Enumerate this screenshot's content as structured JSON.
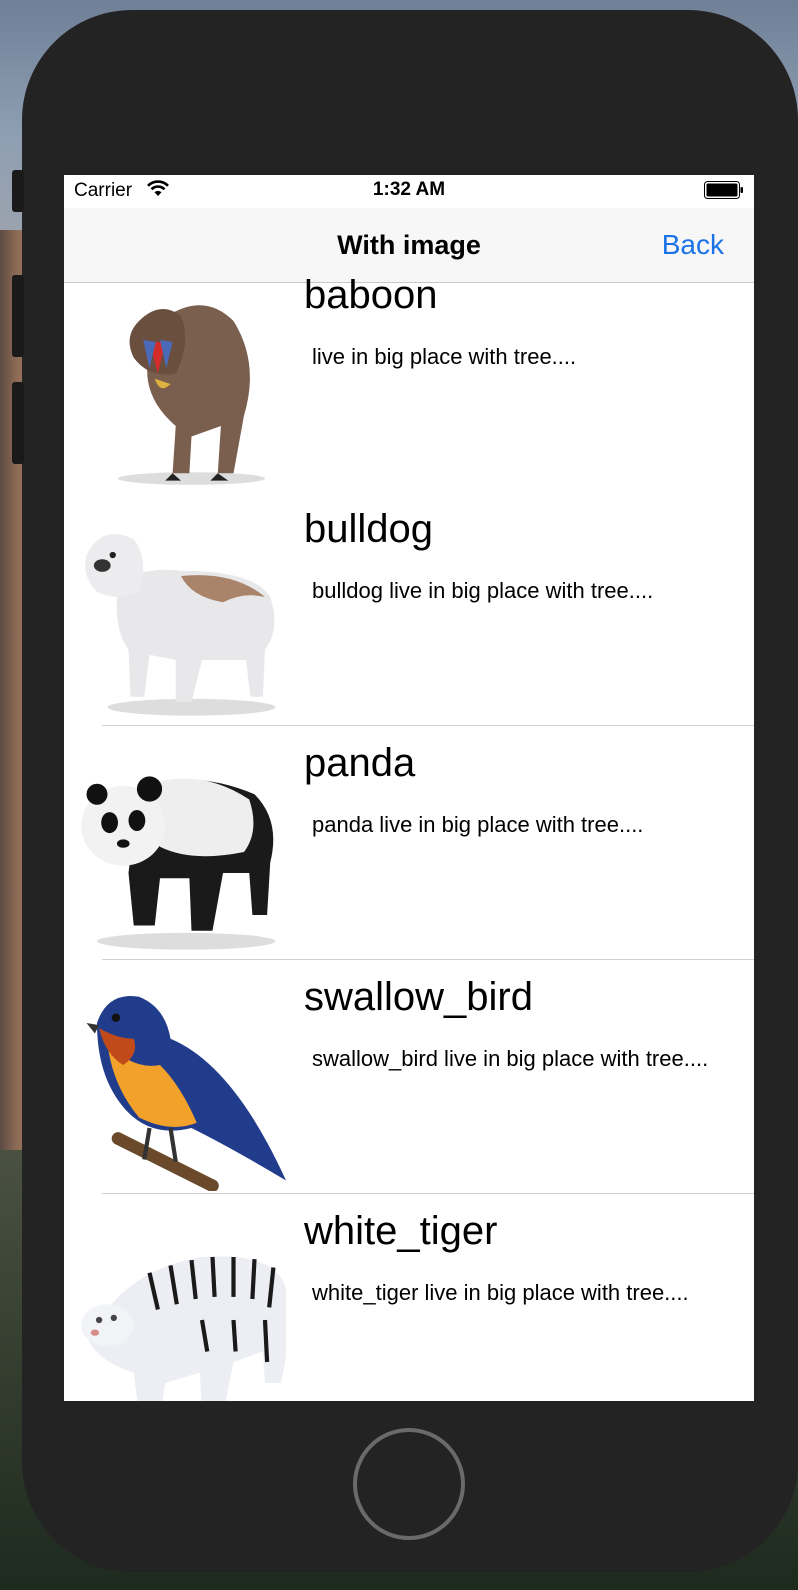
{
  "status_bar": {
    "carrier": "Carrier",
    "time": "1:32 AM"
  },
  "nav": {
    "title": "With image",
    "back_label": "Back"
  },
  "rows": [
    {
      "name": "baboon",
      "desc": "live in  big place with tree...."
    },
    {
      "name": "bulldog",
      "desc": "bulldog live in  big place with tree...."
    },
    {
      "name": "panda",
      "desc": "panda live in  big place with tree...."
    },
    {
      "name": "swallow_bird",
      "desc": "swallow_bird live in  big place with tree...."
    },
    {
      "name": "white_tiger",
      "desc": "white_tiger live in  big place with tree...."
    }
  ],
  "colors": {
    "accent": "#1a73e8",
    "phone_body": "#232323",
    "navbar": "#f7f7f7"
  }
}
